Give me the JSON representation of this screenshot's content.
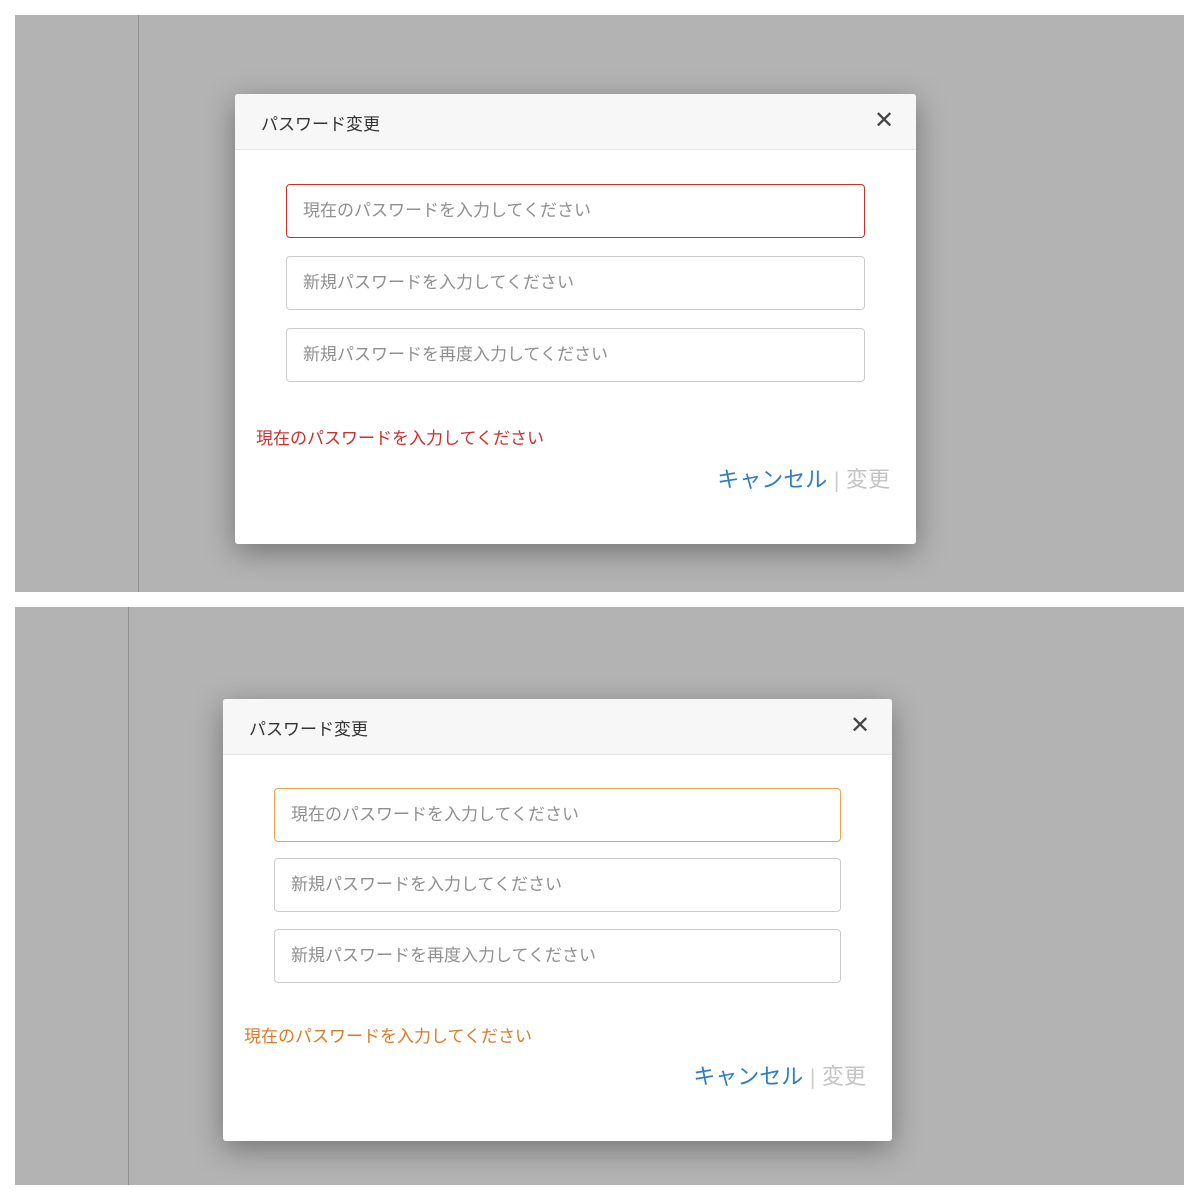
{
  "dialog": {
    "title": "パスワード変更",
    "close_label": "✕",
    "fields": {
      "current_placeholder": "現在のパスワードを入力してください",
      "new_placeholder": "新規パスワードを入力してください",
      "confirm_placeholder": "新規パスワードを再度入力してください"
    },
    "validation_message": "現在のパスワードを入力してください",
    "cancel_label": "キャンセル",
    "separator": "|",
    "change_label": "変更"
  },
  "colors": {
    "error_red": "#c9302c",
    "warning_orange": "#e8a44a",
    "link_blue": "#2e7fc1",
    "disabled_gray": "#c4c4c4",
    "overlay_gray": "#b3b3b3"
  }
}
